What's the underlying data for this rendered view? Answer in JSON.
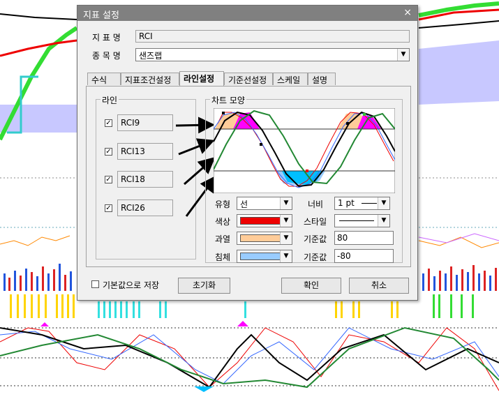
{
  "dialog": {
    "title": "지표 설정",
    "close_glyph": "×",
    "indicator_name_label": "지 표 명",
    "indicator_name_value": "RCI",
    "symbol_label": "종 목 명",
    "symbol_value": "샌즈랩",
    "tabs": [
      {
        "label": "수식"
      },
      {
        "label": "지표조건설정"
      },
      {
        "label": "라인설정"
      },
      {
        "label": "기준선설정"
      },
      {
        "label": "스케일"
      },
      {
        "label": "설명"
      }
    ],
    "active_tab": "라인설정",
    "line_group_title": "라인",
    "lines": [
      {
        "label": "RCI9",
        "checked": true
      },
      {
        "label": "RCI13",
        "checked": true
      },
      {
        "label": "RCI18",
        "checked": true
      },
      {
        "label": "RCI26",
        "checked": true
      }
    ],
    "check_glyph": "✓",
    "chart_shape_title": "차트 모양",
    "type_label": "유형",
    "type_value": "선",
    "width_label": "너비",
    "width_value": "1 pt",
    "color_label": "색상",
    "style_label": "스타일",
    "overheat_label": "과열",
    "base_label_1": "기준값",
    "base_value_1": "80",
    "oversold_label": "침체",
    "base_label_2": "기준값",
    "base_value_2": "-80",
    "save_default_label": "기본값으로 저장",
    "reset_button": "초기화",
    "ok_button": "확인",
    "cancel_button": "취소"
  },
  "colors": {
    "line_color": "#ee0000",
    "overheat_color": "#ffcc99",
    "oversold_color": "#99ccff",
    "overheat_fill": "#ff00ff",
    "oversold_fill": "#00bfff",
    "title_bar": "#808080"
  },
  "icons": {
    "dropdown": "chevron-down-icon",
    "close": "close-icon",
    "check": "check-icon"
  }
}
